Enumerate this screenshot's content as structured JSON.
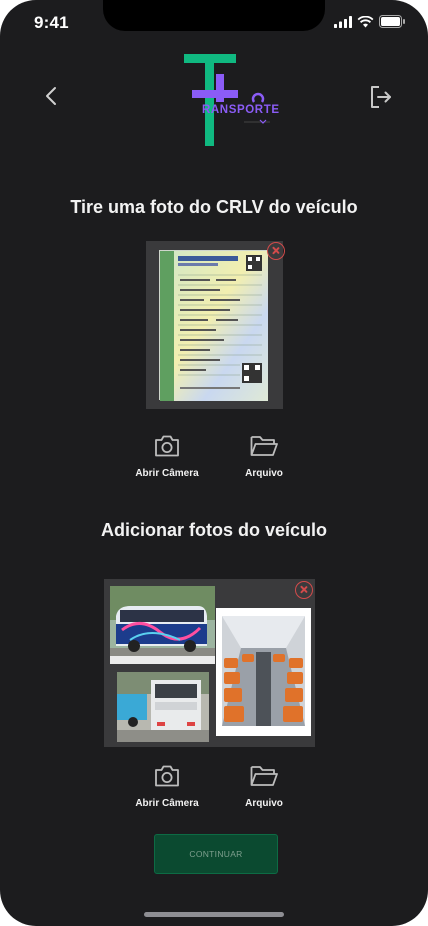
{
  "status_bar": {
    "time": "9:41"
  },
  "brand": {
    "logo_text": "RANSPORTE"
  },
  "crlv_section": {
    "title": "Tire uma foto do CRLV do veículo",
    "camera_label": "Abrir Câmera",
    "file_label": "Arquivo"
  },
  "vehicle_section": {
    "title": "Adicionar fotos do veículo",
    "camera_label": "Abrir Câmera",
    "file_label": "Arquivo"
  },
  "continue_button": {
    "label": "CONTINUAR"
  },
  "colors": {
    "background": "#1c1c1e",
    "logo_green": "#10b981",
    "logo_purple": "#8b5cf6",
    "remove_red": "#d24b4b",
    "button_green": "#0b4a30"
  }
}
